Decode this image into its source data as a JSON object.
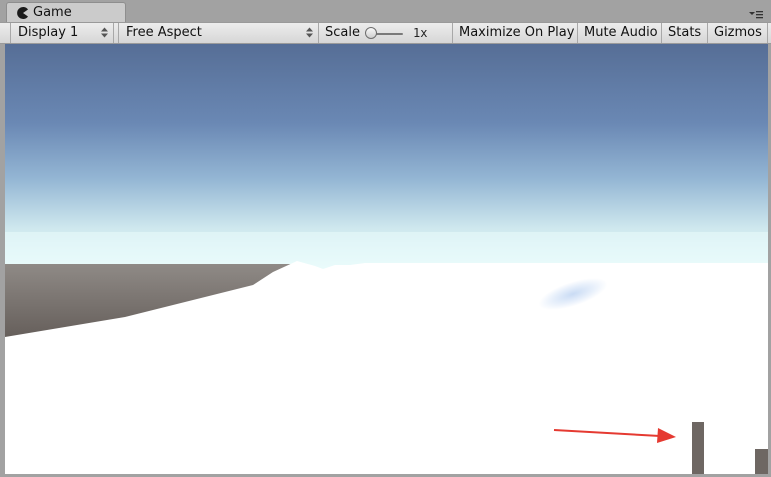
{
  "window": {
    "tab_title": "Game",
    "tab_icon": "pacman-icon"
  },
  "toolbar": {
    "display": "Display 1",
    "aspect": "Free Aspect",
    "scale_label": "Scale",
    "scale_value": "1x",
    "maximize_on_play": "Maximize On Play",
    "mute_audio": "Mute Audio",
    "stats": "Stats",
    "gizmos": "Gizmos"
  },
  "scene": {
    "sky_color_top": "#566e96",
    "horizon_color": "#e8fbfb",
    "ground_color": "#6d6561",
    "snow_color": "#ffffff",
    "pillar_color": "#6e6763",
    "annotation_arrow_color": "#e53a31"
  }
}
